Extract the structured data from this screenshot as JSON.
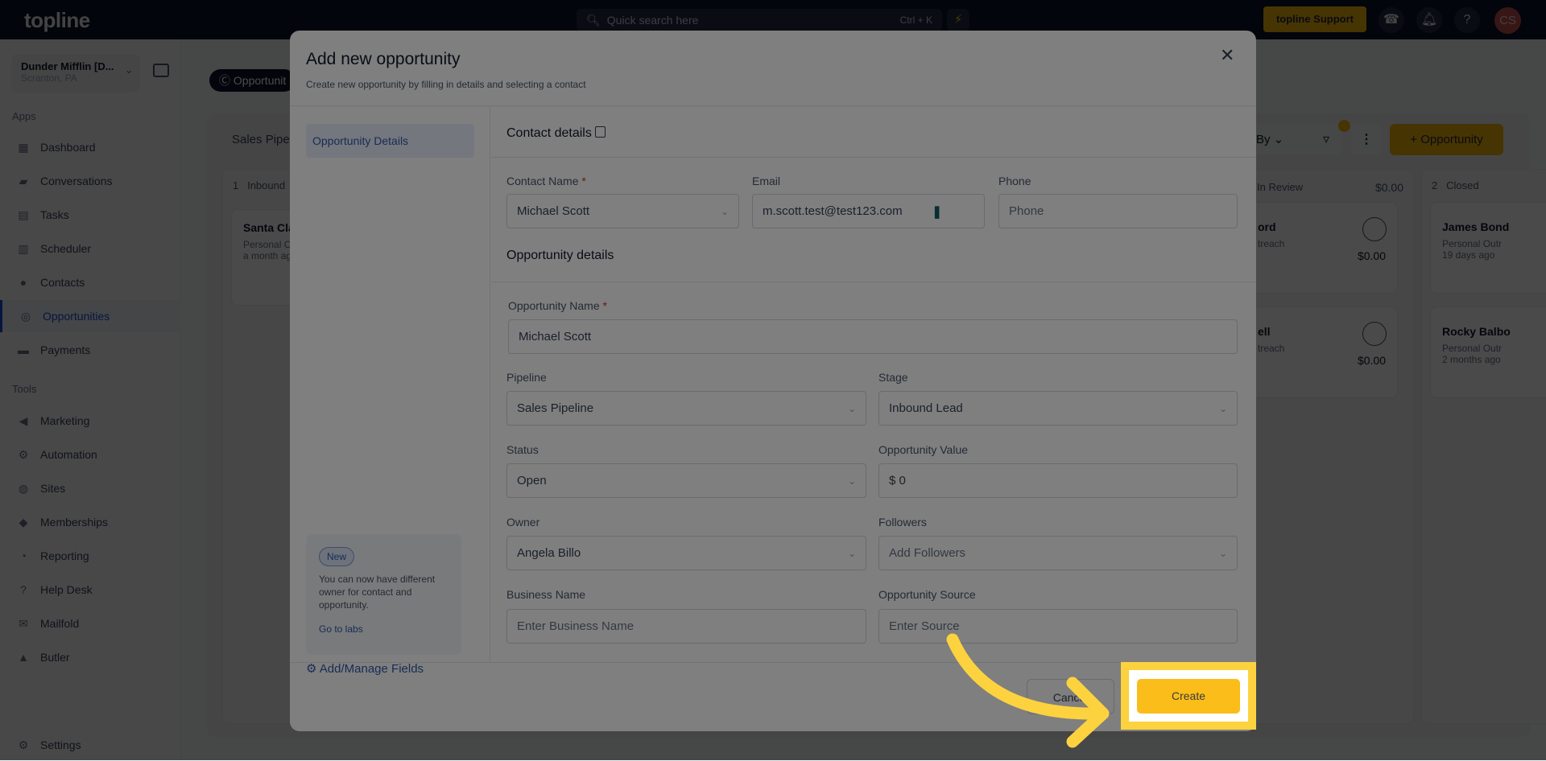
{
  "topbar": {
    "logo": "topline",
    "search_placeholder": "Quick search here",
    "search_shortcut": "Ctrl + K",
    "support_label": "topline Support",
    "avatar_initials": "CS"
  },
  "sidebar": {
    "location_name": "Dunder Mifflin [D...",
    "location_sub": "Scranton, PA",
    "apps_heading": "Apps",
    "tools_heading": "Tools",
    "apps": [
      {
        "label": "Dashboard",
        "icon": "dashboard-icon"
      },
      {
        "label": "Conversations",
        "icon": "chat-icon"
      },
      {
        "label": "Tasks",
        "icon": "tasks-icon"
      },
      {
        "label": "Scheduler",
        "icon": "calendar-icon"
      },
      {
        "label": "Contacts",
        "icon": "user-icon"
      },
      {
        "label": "Opportunities",
        "icon": "target-icon"
      },
      {
        "label": "Payments",
        "icon": "card-icon"
      }
    ],
    "tools": [
      {
        "label": "Marketing",
        "icon": "megaphone-icon"
      },
      {
        "label": "Automation",
        "icon": "gears-icon"
      },
      {
        "label": "Sites",
        "icon": "globe-icon"
      },
      {
        "label": "Memberships",
        "icon": "group-icon"
      },
      {
        "label": "Reporting",
        "icon": "pie-icon"
      },
      {
        "label": "Help Desk",
        "icon": "help-icon"
      },
      {
        "label": "Mailfold",
        "icon": "mail-icon"
      },
      {
        "label": "Butler",
        "icon": "bell-icon"
      }
    ],
    "settings": "Settings"
  },
  "page": {
    "tab": "Opportunit",
    "pipeline": "Sales Pipe",
    "sort_label": "By",
    "add_button": "Opportunity",
    "columns": [
      {
        "count": "1",
        "name": "Inbound",
        "cards": [
          {
            "name": "Santa Cla",
            "source": "Personal O",
            "time": "a month ag"
          }
        ]
      },
      {
        "count": "",
        "name": "In Review",
        "total": "$0.00",
        "cards": [
          {
            "name": "ord",
            "source": "treach",
            "value": "$0.00"
          },
          {
            "name": "ell",
            "source": "treach",
            "value": "$0.00"
          }
        ]
      },
      {
        "count": "2",
        "name": "Closed",
        "cards": [
          {
            "name": "James Bond",
            "source": "Personal Outr",
            "time": "19 days ago"
          },
          {
            "name": "Rocky Balbo",
            "source": "Personal Outr",
            "time": "2 months ago"
          }
        ]
      }
    ]
  },
  "modal": {
    "title": "Add new opportunity",
    "subtitle": "Create new opportunity by filling in details and selecting a contact",
    "nav_item": "Opportunity Details",
    "promo": {
      "badge": "New",
      "text": "You can now have different owner for contact and opportunity.",
      "link": "Go to labs"
    },
    "manage_fields": "Add/Manage Fields",
    "contact_section": "Contact details",
    "opportunity_section": "Opportunity details",
    "fields": {
      "contact_name": {
        "label": "Contact Name",
        "value": "Michael Scott"
      },
      "email": {
        "label": "Email",
        "value": "m.scott.test@test123.com"
      },
      "phone": {
        "label": "Phone",
        "placeholder": "Phone"
      },
      "opportunity_name": {
        "label": "Opportunity Name",
        "value": "Michael Scott"
      },
      "pipeline": {
        "label": "Pipeline",
        "value": "Sales Pipeline"
      },
      "stage": {
        "label": "Stage",
        "value": "Inbound Lead"
      },
      "status": {
        "label": "Status",
        "value": "Open"
      },
      "value": {
        "label": "Opportunity Value",
        "value": "$ 0"
      },
      "owner": {
        "label": "Owner",
        "value": "Angela Billo"
      },
      "followers": {
        "label": "Followers",
        "placeholder": "Add Followers"
      },
      "business_name": {
        "label": "Business Name",
        "placeholder": "Enter Business Name"
      },
      "source": {
        "label": "Opportunity Source",
        "placeholder": "Enter Source"
      }
    },
    "required_mark": "*",
    "cancel": "Cancel",
    "create": "Create"
  },
  "colors": {
    "accent": "#fbbd1a",
    "highlight": "#fdd23f",
    "topbar": "#0a1429",
    "link": "#2e5aac"
  }
}
